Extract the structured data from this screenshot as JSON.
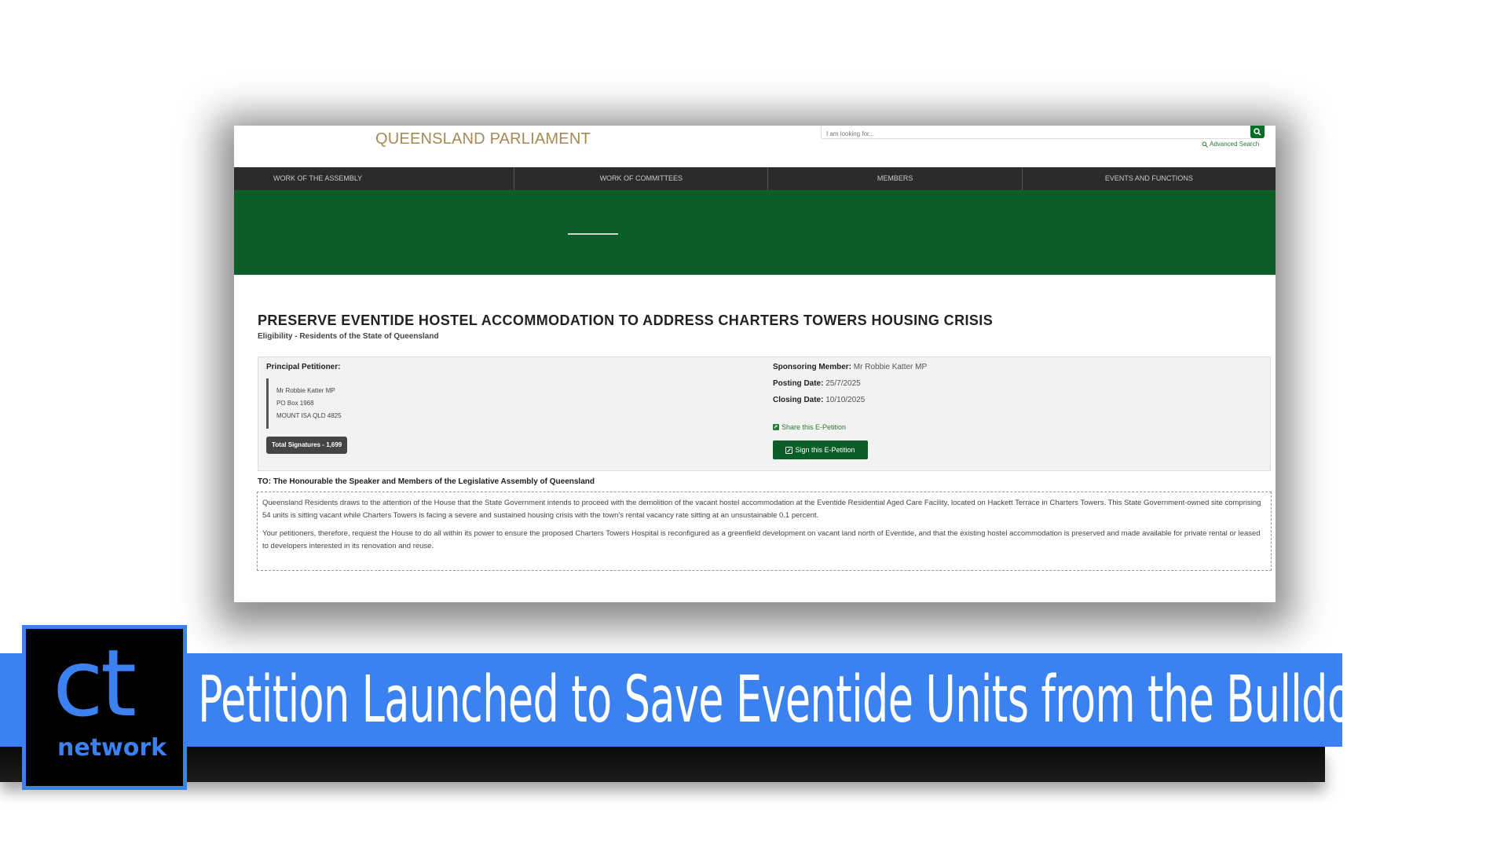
{
  "site": {
    "brand": "QUEENSLAND PARLIAMENT",
    "search_placeholder": "I am looking for...",
    "advanced_search": "Advanced Search"
  },
  "nav": {
    "items": [
      "WORK OF THE ASSEMBLY",
      "WORK OF COMMITTEES",
      "MEMBERS",
      "EVENTS AND FUNCTIONS"
    ]
  },
  "petition": {
    "title": "PRESERVE EVENTIDE HOSTEL ACCOMMODATION TO ADDRESS CHARTERS TOWERS HOUSING CRISIS",
    "eligibility": "Eligibility - Residents of the State of Queensland",
    "principal_label": "Principal Petitioner:",
    "address": [
      "Mr Robbie Katter MP",
      "PO Box 1968",
      "MOUNT ISA QLD 4825"
    ],
    "total_signatures": "Total Signatures - 1,699",
    "sponsoring_label": "Sponsoring Member:",
    "sponsoring_value": "Mr Robbie Katter MP",
    "posting_label": "Posting Date:",
    "posting_value": "25/7/2025",
    "closing_label": "Closing Date:",
    "closing_value": "10/10/2025",
    "share_label": "Share this E-Petition",
    "sign_label": "Sign this E-Petition",
    "to": "TO: The Honourable the Speaker and Members of the Legislative Assembly of Queensland",
    "paragraph1": "Queensland Residents draws to the attention of the House that the State Government intends to proceed with the demolition of the vacant hostel accommodation at the Eventide Residential Aged Care Facility, located on Hackett Terrace in Charters Towers. This State Government-owned site comprising 54 units is sitting vacant while Charters Towers is facing a severe and sustained housing crisis with the town's rental vacancy rate sitting at an unsustainable 0.1 percent.",
    "paragraph2": "Your petitioners, therefore, request the House to do all within its power to ensure the proposed Charters Towers Hospital is reconfigured as a greenfield development on vacant land north of Eventide, and that the existing hostel accommodation is preserved and made available for private rental or leased to developers interested in its renovation and reuse."
  },
  "banner": {
    "headline": "Petition Launched to Save Eventide Units from the Bulldozer",
    "logo_main": "ct",
    "logo_sub": "network"
  },
  "colors": {
    "brand_gold": "#a68a55",
    "nav_bg": "#2b2b2b",
    "hero_green": "#0b5e28",
    "banner_blue": "#3b82f0"
  },
  "icons": [
    "search-icon",
    "share-icon",
    "edit-icon"
  ]
}
